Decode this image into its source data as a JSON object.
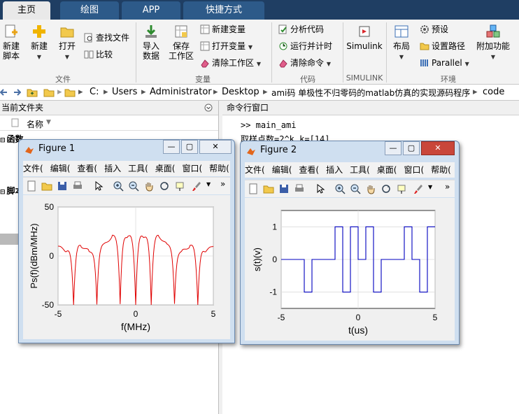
{
  "tabs": [
    "主页",
    "绘图",
    "APP",
    "快捷方式"
  ],
  "ribbon": {
    "file": {
      "new_script": "新建\n脚本",
      "new": "新建",
      "open": "打开",
      "find_files": "查找文件",
      "compare": "比较",
      "group_label": "文件"
    },
    "variable": {
      "import": "导入\n数据",
      "save_workspace": "保存\n工作区",
      "new_variable": "新建变量",
      "open_variable": "打开变量",
      "clear_workspace": "清除工作区",
      "group_label": "变量"
    },
    "code": {
      "analyze": "分析代码",
      "run_time": "运行并计时",
      "clear_commands": "清除命令",
      "group_label": "代码"
    },
    "simulink": {
      "label": "Simulink",
      "group_label": "SIMULINK"
    },
    "environment": {
      "layout": "布局",
      "preferences": "预设",
      "set_path": "设置路径",
      "parallel": "Parallel",
      "addons": "附加功能",
      "group_label": "环境"
    }
  },
  "address": {
    "drive": "C:",
    "parts": [
      "Users",
      "Administrator",
      "Desktop",
      "ami码 单极性不归零码的matlab仿真的实现源码程序",
      "code"
    ]
  },
  "current_folder": {
    "title": "当前文件夹",
    "col_name": "名称",
    "section_functions": "函数",
    "section_scripts": "脚本"
  },
  "command_window": {
    "title": "命令行窗口",
    "lines": [
      ">> main_ami",
      "取样点数=2^k k=[14]"
    ]
  },
  "figure1": {
    "title": "Figure 1",
    "menus": [
      "文件(",
      "编辑(",
      "查看(",
      "插入",
      "工具(",
      "桌面(",
      "窗口(",
      "帮助("
    ]
  },
  "figure2": {
    "title": "Figure 2",
    "menus": [
      "文件(",
      "编辑(",
      "查看(",
      "插入",
      "工具(",
      "桌面(",
      "窗口(",
      "帮助("
    ]
  },
  "chart_data": [
    {
      "type": "line",
      "xlabel": "f(MHz)",
      "ylabel": "Ps(f)(dBm/MHz)",
      "xlim": [
        -5,
        5
      ],
      "ylim": [
        -50,
        50
      ],
      "xticks": [
        "-5",
        "0",
        "5"
      ],
      "yticks": [
        "50",
        "0",
        "-50"
      ],
      "grid": true,
      "color": "#e00000",
      "x": [
        -5,
        -4.5,
        -4,
        -3.5,
        -3,
        -2.5,
        -2,
        -1.5,
        -1,
        -0.5,
        0,
        0.5,
        1,
        1.5,
        2,
        2.5,
        3,
        3.5,
        4,
        4.5,
        5
      ],
      "y": [
        10,
        5,
        -50,
        10,
        5,
        -50,
        12,
        20,
        -50,
        20,
        -50,
        20,
        -50,
        20,
        12,
        -50,
        5,
        10,
        -50,
        5,
        10
      ]
    },
    {
      "type": "line",
      "xlabel": "t(us)",
      "ylabel": "s(t)(v)",
      "xlim": [
        -5,
        5
      ],
      "ylim": [
        -1.5,
        1.5
      ],
      "xticks": [
        "-5",
        "0",
        "5"
      ],
      "yticks": [
        "1",
        "0",
        "-1"
      ],
      "grid": true,
      "color": "#0000c0",
      "steps": [
        [
          -5,
          0
        ],
        [
          -3.5,
          -1
        ],
        [
          -3,
          0
        ],
        [
          -1.5,
          1
        ],
        [
          -1,
          -1
        ],
        [
          -0.5,
          1
        ],
        [
          0,
          0
        ],
        [
          0.5,
          1
        ],
        [
          1,
          -1
        ],
        [
          1.5,
          0
        ],
        [
          3,
          1
        ],
        [
          3.5,
          0
        ],
        [
          4,
          -1
        ],
        [
          4.5,
          1
        ],
        [
          5,
          1
        ]
      ]
    }
  ]
}
